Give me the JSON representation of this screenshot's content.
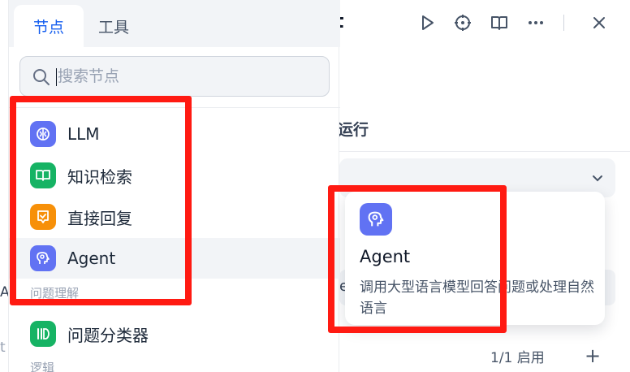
{
  "background": {
    "title_fragment": "t",
    "run_label": "运行",
    "input_fragment": "e",
    "enable_count": "1/1 启用",
    "add_label": "+",
    "edge_fragment_a": "A",
    "edge_fragment_b": "t"
  },
  "picker": {
    "tabs": [
      {
        "label": "节点",
        "active": true
      },
      {
        "label": "工具",
        "active": false
      }
    ],
    "search": {
      "placeholder": "搜索节点",
      "value": ""
    },
    "items": [
      {
        "label": "LLM",
        "icon": "brain-icon",
        "color": "#6172f3"
      },
      {
        "label": "知识检索",
        "icon": "book-icon",
        "color": "#16b364"
      },
      {
        "label": "直接回复",
        "icon": "reply-icon",
        "color": "#f79009"
      },
      {
        "label": "Agent",
        "icon": "agent-icon",
        "color": "#6172f3"
      }
    ],
    "group_question": "问题理解",
    "classifier": {
      "label": "问题分类器",
      "icon": "classifier-icon",
      "color": "#16b364"
    },
    "group_logic": "逻辑"
  },
  "tooltip": {
    "title": "Agent",
    "description": "调用大型语言模型回答问题或处理自然语言",
    "icon": "agent-icon",
    "color": "#6172f3"
  },
  "colors": {
    "accent": "#155eef",
    "annotation_red": "#ff1a12"
  }
}
